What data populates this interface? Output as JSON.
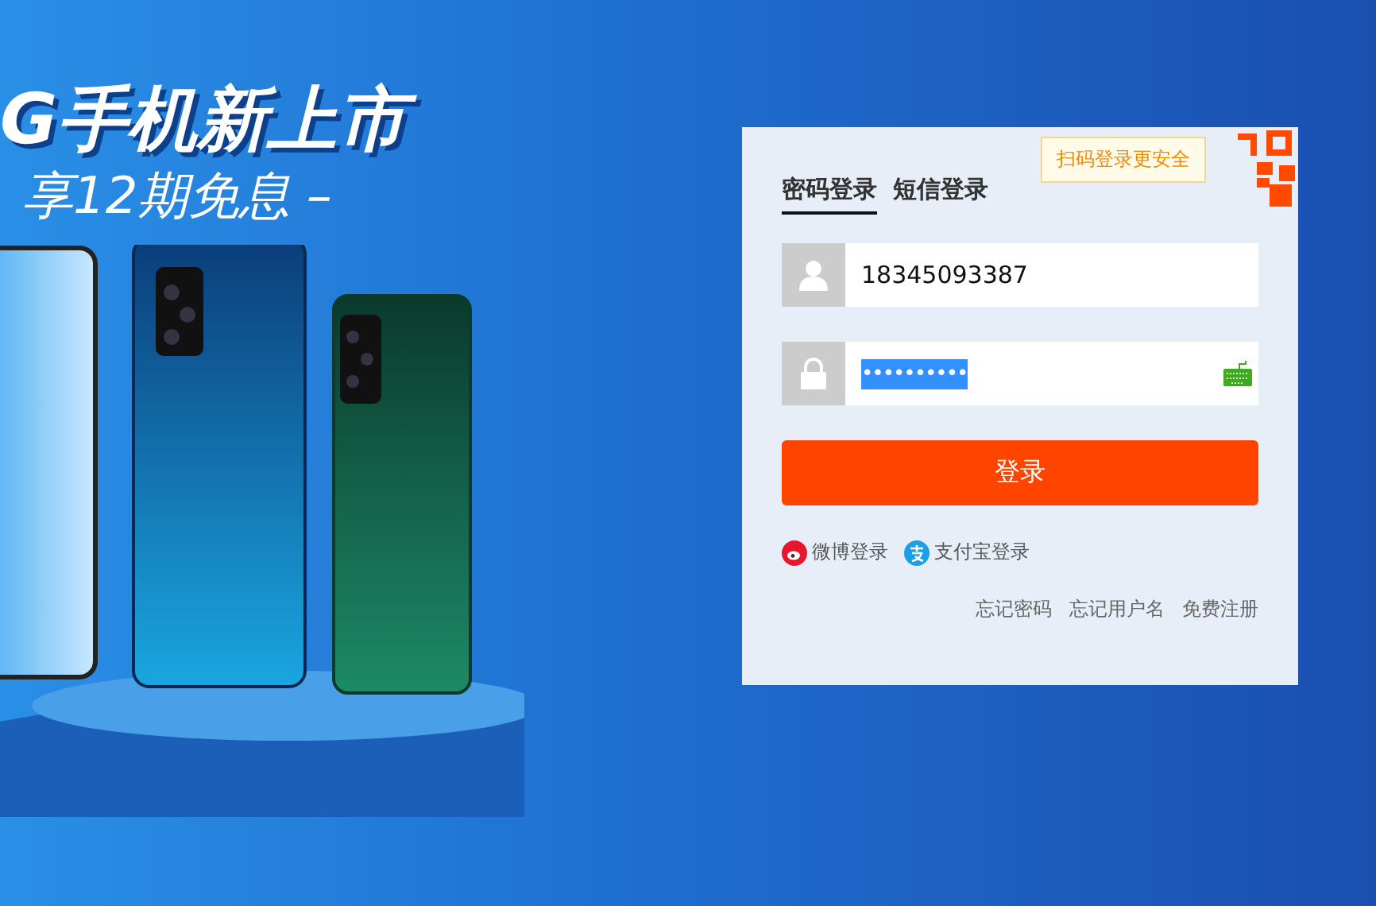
{
  "banner": {
    "headline": "G手机新上市",
    "subline": "享12期免息 –"
  },
  "login": {
    "qr_hint": "扫码登录更安全",
    "tabs": [
      {
        "label": "密码登录",
        "selected": true
      },
      {
        "label": "短信登录",
        "selected": false
      }
    ],
    "username": {
      "value": "18345093387"
    },
    "password": {
      "value": "••••••••••",
      "highlighted": true
    },
    "submit": "登录",
    "social": [
      {
        "kind": "weibo",
        "label": "微博登录"
      },
      {
        "kind": "alipay",
        "label": "支付宝登录"
      }
    ],
    "links": [
      "忘记密码",
      "忘记用户名",
      "免费注册"
    ]
  }
}
